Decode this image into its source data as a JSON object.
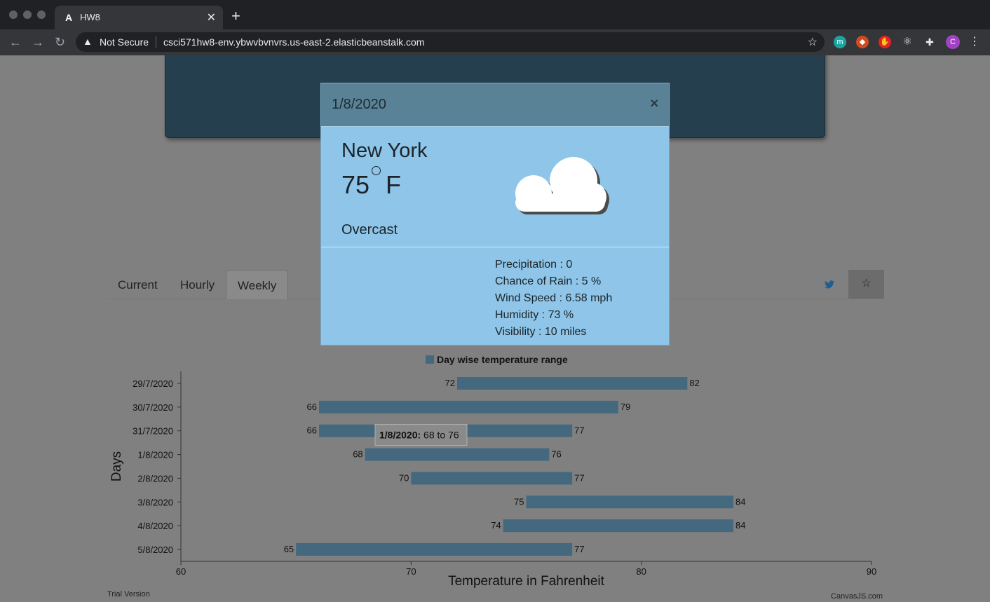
{
  "browser": {
    "tab_title": "HW8",
    "tab_favicon": "A",
    "security_label": "Not Secure",
    "url": "csci571hw8-env.ybwvbvnvrs.us-east-2.elasticbeanstalk.com",
    "profile_initial": "C",
    "extension_m": "m"
  },
  "page": {
    "tabs": [
      {
        "label": "Current"
      },
      {
        "label": "Hourly"
      },
      {
        "label": "Weekly"
      }
    ],
    "active_tab": "Weekly"
  },
  "modal": {
    "date": "1/8/2020",
    "close": "×",
    "city": "New York",
    "temperature": "75",
    "unit": "F",
    "condition": "Overcast",
    "icon": "cloud-icon",
    "details": [
      "Precipitation : 0",
      "Chance of Rain : 5 %",
      "Wind Speed : 6.58 mph",
      "Humidity : 73 %",
      "Visibility : 10 miles"
    ]
  },
  "chart_data": {
    "type": "bar",
    "orientation": "horizontal-range",
    "legend": "Day wise temperature range",
    "xlabel": "Temperature in Fahrenheit",
    "ylabel": "Days",
    "xlim": [
      60,
      90
    ],
    "x_ticks": [
      "60",
      "70",
      "80",
      "90"
    ],
    "categories": [
      "29/7/2020",
      "30/7/2020",
      "31/7/2020",
      "1/8/2020",
      "2/8/2020",
      "3/8/2020",
      "4/8/2020",
      "5/8/2020"
    ],
    "low": [
      72,
      66,
      66,
      68,
      70,
      75,
      74,
      65
    ],
    "high": [
      82,
      79,
      77,
      76,
      77,
      84,
      84,
      77
    ],
    "bar_color": "#44697e",
    "tooltip": {
      "category": "1/8/2020",
      "text_bold": "1/8/2020:",
      "text": " 68 to 76"
    }
  },
  "footer": {
    "trial": "Trial Version",
    "credit": "CanvasJS.com"
  }
}
